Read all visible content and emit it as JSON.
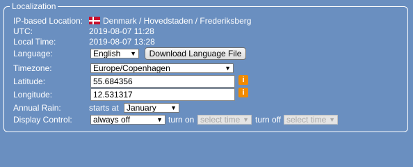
{
  "legend": "Localization",
  "ip_location": {
    "label": "IP-based Location:",
    "flag": "denmark-flag",
    "value": "Denmark / Hovedstaden / Frederiksberg"
  },
  "utc": {
    "label": "UTC:",
    "value": "2019-08-07 11:28"
  },
  "local_time": {
    "label": "Local Time:",
    "value": "2019-08-07 13:28"
  },
  "language": {
    "label": "Language:",
    "selected": "English",
    "button": "Download Language File"
  },
  "timezone": {
    "label": "Timezone:",
    "selected": "Europe/Copenhagen"
  },
  "latitude": {
    "label": "Latitude:",
    "value": "55.684356",
    "info": "i"
  },
  "longitude": {
    "label": "Longitude:",
    "value": "12.531317",
    "info": "i"
  },
  "annual_rain": {
    "label": "Annual Rain:",
    "prefix": "starts at",
    "selected": "January"
  },
  "display_control": {
    "label": "Display Control:",
    "selected": "always off",
    "turn_on_label": "turn on",
    "turn_on_value": "select time",
    "turn_off_label": "turn off",
    "turn_off_value": "select time"
  },
  "colors": {
    "background": "#6a8fc0",
    "info_icon": "#f08a00",
    "flag_red": "#c8102e"
  }
}
